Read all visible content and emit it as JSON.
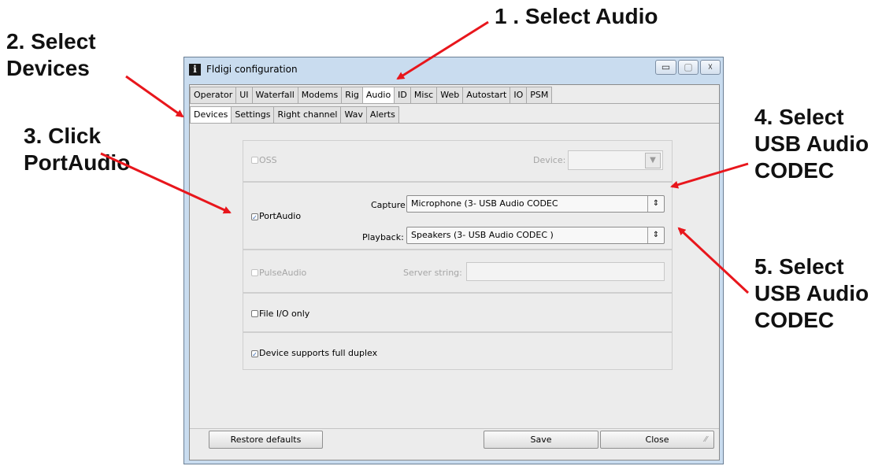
{
  "annotations": {
    "step1": "1 . Select Audio",
    "step2": "2. Select\nDevices",
    "step3": "3. Click\nPortAudio",
    "step4": "4. Select\nUSB Audio\nCODEC",
    "step5": "5. Select\nUSB Audio\nCODEC",
    "arrow_color": "#e8161c"
  },
  "window": {
    "title": "Fldigi configuration",
    "app_icon": "i",
    "min_icon": "▭",
    "max_icon": "▢",
    "close_icon": "☓"
  },
  "tabs_main": [
    "Operator",
    "UI",
    "Waterfall",
    "Modems",
    "Rig",
    "Audio",
    "ID",
    "Misc",
    "Web",
    "Autostart",
    "IO",
    "PSM"
  ],
  "tabs_main_active": "Audio",
  "tabs_audio": [
    "Devices",
    "Settings",
    "Right channel",
    "Wav",
    "Alerts"
  ],
  "tabs_audio_active": "Devices",
  "devices": {
    "oss_label": "OSS",
    "oss_device_label": "Device:",
    "portaudio_label": "PortAudio",
    "capture_label": "Capture:",
    "capture_value": "Microphone (3- USB Audio CODEC",
    "playback_label": "Playback:",
    "playback_value": "Speakers (3- USB Audio CODEC )",
    "pulseaudio_label": "PulseAudio",
    "server_string_label": "Server string:",
    "file_io_label": "File I/O only",
    "full_duplex_label": "Device supports full duplex",
    "checked_mark": "✓",
    "combo_arrow": "⇕",
    "combo_arrow_disabled": "▼"
  },
  "footer": {
    "restore_defaults": "Restore defaults",
    "save": "Save",
    "close": "Close",
    "grip": "⁄⁄"
  }
}
